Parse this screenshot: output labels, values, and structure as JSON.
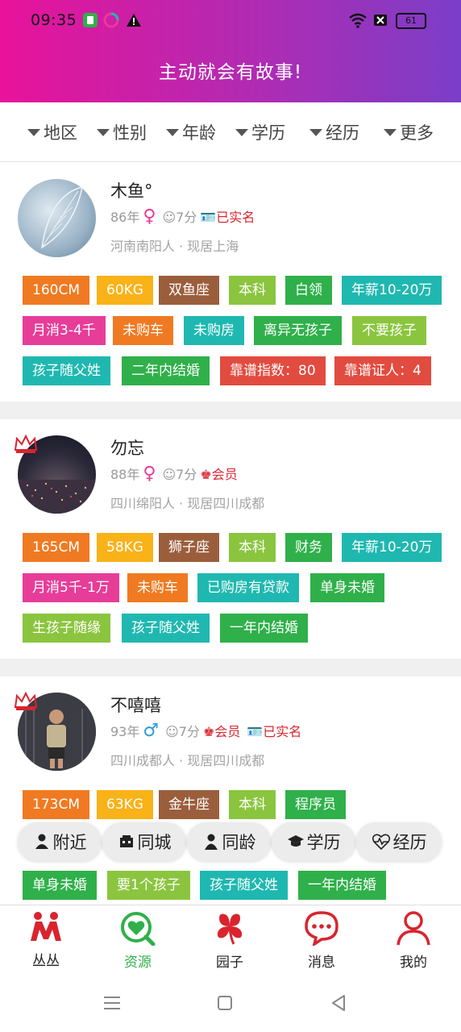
{
  "status_bar": {
    "time": "09:35",
    "battery": "61"
  },
  "header": {
    "title": "主动就会有故事!"
  },
  "filters": [
    "地区",
    "性别",
    "年龄",
    "学历",
    "经历",
    "更多"
  ],
  "profiles": [
    {
      "name": "木鱼°",
      "year": "86年",
      "gender": "female",
      "gender_symbol": "♀",
      "score": "☺7分",
      "badges": [
        "已实名"
      ],
      "location": "河南南阳人 · 现居上海",
      "tags": [
        "160CM",
        "60KG",
        "双鱼座",
        "本科",
        "白领",
        "年薪10-20万",
        "月消3-4千",
        "未购车",
        "未购房",
        "离异无孩子",
        "不要孩子",
        "孩子随父姓",
        "二年内结婚",
        "靠谱指数：80",
        "靠谱证人：4"
      ]
    },
    {
      "name": "勿忘",
      "year": "88年",
      "gender": "female",
      "gender_symbol": "♀",
      "score": "☺7分",
      "badges": [
        "会员"
      ],
      "location": "四川绵阳人 · 现居四川成都",
      "tags": [
        "165CM",
        "58KG",
        "狮子座",
        "本科",
        "财务",
        "年薪10-20万",
        "月消5千-1万",
        "未购车",
        "已购房有贷款",
        "单身未婚",
        "生孩子随缘",
        "孩子随父姓",
        "一年内结婚"
      ]
    },
    {
      "name": "不嘻嘻",
      "year": "93年",
      "gender": "male",
      "gender_symbol": "♂",
      "score": "☺7分",
      "badges": [
        "会员",
        "已实名"
      ],
      "location": "四川成都人 · 现居四川成都",
      "tags": [
        "173CM",
        "63KG",
        "金牛座",
        "本科",
        "程序员",
        "单身未婚",
        "要1个孩子",
        "孩子随父姓",
        "一年内结婚"
      ]
    }
  ],
  "quick_filters": [
    "附近",
    "同城",
    "同龄",
    "学历",
    "经历"
  ],
  "bottom_nav": [
    {
      "label": "丛丛",
      "icon": "people-icon"
    },
    {
      "label": "资源",
      "icon": "heart-search-icon"
    },
    {
      "label": "园子",
      "icon": "clover-icon"
    },
    {
      "label": "消息",
      "icon": "chat-icon"
    },
    {
      "label": "我的",
      "icon": "person-icon"
    }
  ],
  "colors": {
    "orange": "#f07a22",
    "yellow": "#f9b218",
    "brown": "#9b5e3c",
    "lightgreen": "#8bc53f",
    "green": "#2fb04a",
    "teal": "#1fb8b0",
    "pink": "#e63d99",
    "red": "#e24b3f",
    "active": "#2fb04a"
  }
}
